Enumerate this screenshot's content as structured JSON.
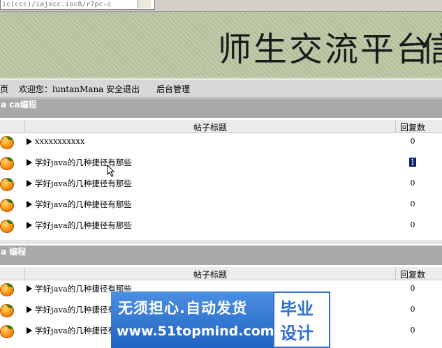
{
  "browser": {
    "address_fragment": "ic(ccc)/iajxcc.ioc8/r7pc-c"
  },
  "banner": {
    "title": "师生交流平台",
    "trailing_glyph": "信"
  },
  "nav": {
    "home": "页",
    "welcome": "欢迎您：luntanMana",
    "logout": "安全退出",
    "admin": "后台管理"
  },
  "boards": [
    {
      "name": "a ca编程",
      "header": {
        "title": "帖子标题",
        "replies": "回复数"
      },
      "posts": [
        {
          "title": "xxxxxxxxxxx",
          "replies": "0"
        },
        {
          "title": "学好java的几种捷径有那些",
          "replies": "1",
          "selected": true
        },
        {
          "title": "学好java的几种捷径有那些",
          "replies": "0"
        },
        {
          "title": "学好java的几种捷径有那些",
          "replies": "0"
        },
        {
          "title": "学好java的几种捷径有那些",
          "replies": "0"
        }
      ]
    },
    {
      "name": "a 编程",
      "header": {
        "title": "帖子标题",
        "replies": "回复数"
      },
      "posts": [
        {
          "title": "学好java的几种捷径有那些",
          "replies": "0"
        },
        {
          "title": "学好java的几种捷径有那些",
          "replies": "0"
        },
        {
          "title": "学好java的几种捷径有那些",
          "replies": "0"
        }
      ]
    }
  ],
  "watermark": {
    "line1": "无须担心.自动发货",
    "line2": "www.51topmind.com",
    "right1": "毕业",
    "right2": "设计"
  },
  "colors": {
    "board_header": "#a9a9a9",
    "nav_bg": "#d8d8d8",
    "watermark_blue": "#2f6fd0"
  },
  "icons": {
    "post_icon": "orange-fruit-icon",
    "row_marker": "triangle-right-icon"
  }
}
